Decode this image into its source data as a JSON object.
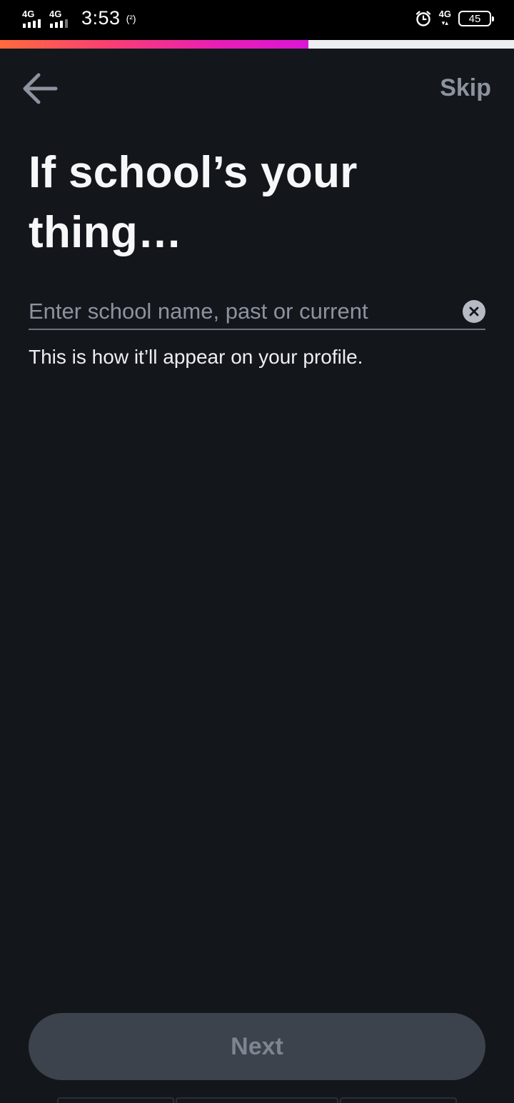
{
  "status_bar": {
    "sim1_network": "4G",
    "sim2_network": "4G",
    "time": "3:53",
    "hotspot": "(²)",
    "data_network": "4G",
    "battery": "45"
  },
  "progress": {
    "fraction": 0.6
  },
  "nav": {
    "skip_label": "Skip"
  },
  "title": "If school’s your thing…",
  "input": {
    "value": "",
    "placeholder": "Enter school name, past or current"
  },
  "helper_text": "This is how it’ll appear on your profile.",
  "next_label": "Next",
  "colors": {
    "background": "#13161b",
    "progress_start": "#fd6b3d",
    "progress_end": "#da16d6",
    "muted": "#8d939e",
    "button_disabled": "#3d434c"
  },
  "icons": {
    "back": "arrow-left-icon",
    "clear": "close-circle-icon",
    "alarm": "alarm-icon"
  }
}
